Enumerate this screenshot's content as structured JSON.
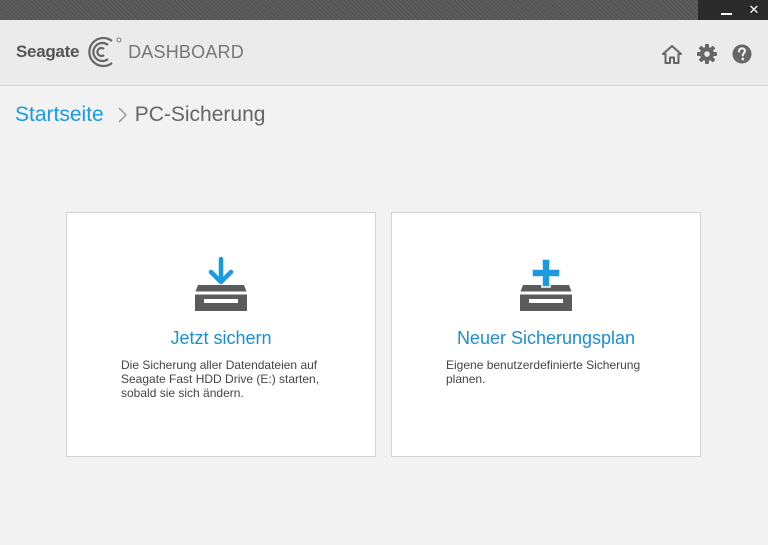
{
  "window": {
    "minimize_label": "–",
    "close_label": "✕"
  },
  "header": {
    "brand": "Seagate",
    "product": "DASHBOARD",
    "icons": [
      "home-icon",
      "gear-icon",
      "help-icon"
    ]
  },
  "breadcrumb": {
    "home": "Startseite",
    "current": "PC-Sicherung"
  },
  "cards": [
    {
      "title": "Jetzt sichern",
      "description": "Die Sicherung aller Datendateien auf Seagate Fast HDD Drive (E:) starten, sobald sie sich ändern.",
      "icon": "drive-download-icon"
    },
    {
      "title": "Neuer Sicherungsplan",
      "description": "Eigene benutzerdefinierte Sicherung planen.",
      "icon": "drive-add-icon"
    }
  ],
  "colors": {
    "accent": "#1a9be0",
    "icon_gray": "#5b5b5b",
    "background": "#f2f2f2"
  }
}
